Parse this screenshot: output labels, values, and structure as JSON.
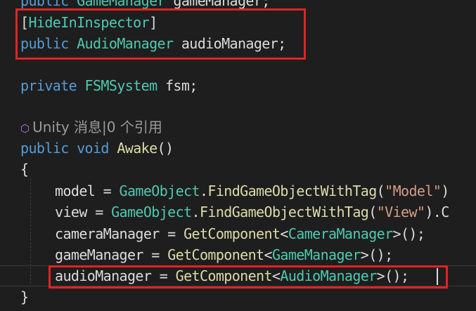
{
  "code": {
    "line0": {
      "kw": "public",
      "type": "GameManager",
      "name": "gameManager;"
    },
    "line1": {
      "open": "[",
      "attr": "HideInInspector",
      "close": "]"
    },
    "line2": {
      "kw": "public",
      "type": "AudioManager",
      "name": "audioManager;"
    },
    "line3": {
      "kw": "private",
      "type": "FSMSystem",
      "name": "fsm;"
    },
    "hint": {
      "icon": "⬡",
      "text": "Unity 消息|0 个引用"
    },
    "line5": {
      "kw1": "public",
      "kw2": "void",
      "fn": "Awake",
      "paren": "()"
    },
    "open_brace": "{",
    "line7": {
      "var": "model = ",
      "type": "GameObject",
      "dot": ".",
      "fn": "FindGameObjectWithTag",
      "p1": "(",
      "str": "\"Model\"",
      "rest": ")"
    },
    "line8": {
      "var": "view = ",
      "type": "GameObject",
      "dot": ".",
      "fn": "FindGameObjectWithTag",
      "p1": "(",
      "str": "\"View\"",
      "rest": ").C"
    },
    "line9": {
      "var": "cameraManager = ",
      "fn": "GetComponent",
      "lt": "<",
      "type": "CameraManager",
      "rest": ">();"
    },
    "line10": {
      "var": "gameManager = ",
      "fn": "GetComponent",
      "lt": "<",
      "type": "GameManager",
      "rest": ">();"
    },
    "line11": {
      "var": "audioManager = ",
      "fn": "GetComponent",
      "lt": "<",
      "type": "AudioManager",
      "rest": ">();"
    },
    "close_brace": "}"
  },
  "highlight_color": "#e22323"
}
